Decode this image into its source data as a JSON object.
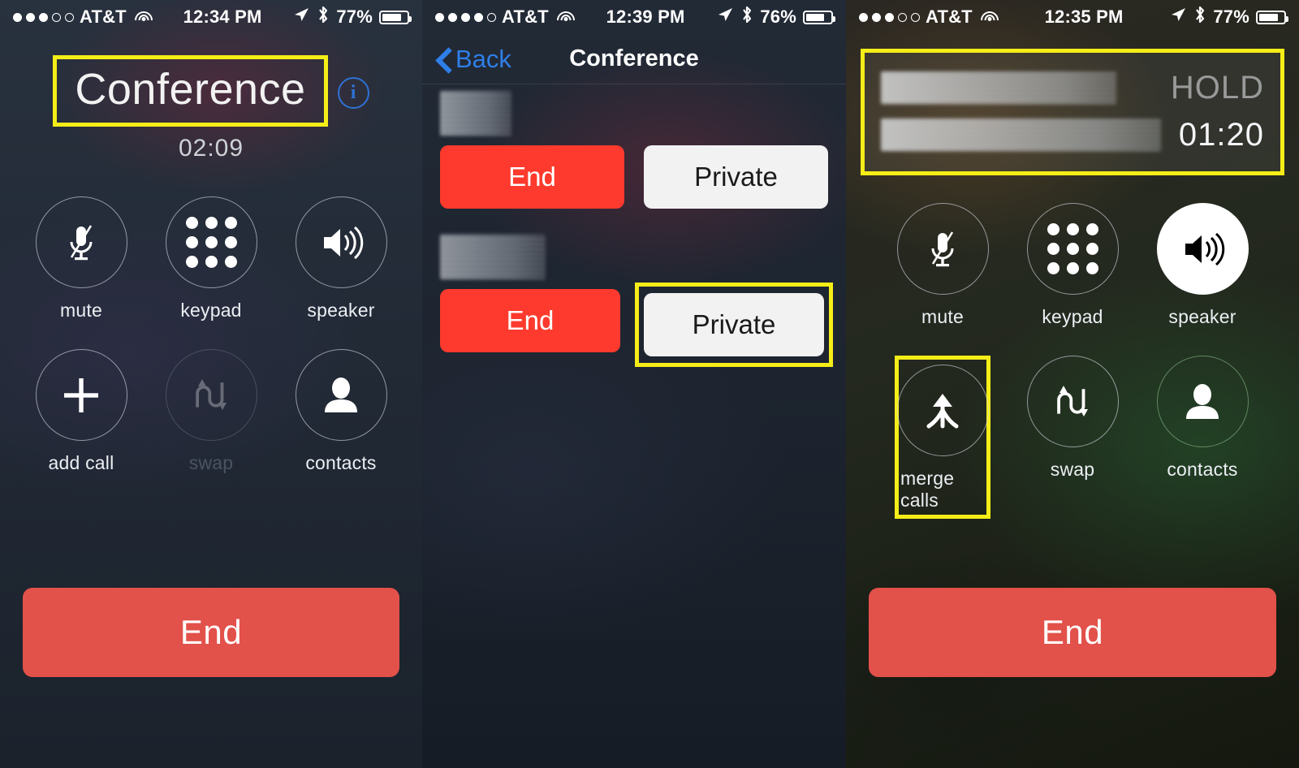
{
  "panels": {
    "left": {
      "status": {
        "carrier": "AT&T",
        "signal_filled": 3,
        "signal_total": 5,
        "time": "12:34 PM",
        "battery": "77%",
        "wifi_icon": "wifi-icon",
        "location_icon": "location-arrow-icon",
        "bluetooth_icon": "bluetooth-icon"
      },
      "call": {
        "title": "Conference",
        "timer": "02:09",
        "info_icon": "info-circle-icon"
      },
      "buttons": [
        {
          "label": "mute",
          "icon": "microphone-muted-icon",
          "state": "normal"
        },
        {
          "label": "keypad",
          "icon": "keypad-dots-icon",
          "state": "normal"
        },
        {
          "label": "speaker",
          "icon": "speaker-waves-icon",
          "state": "normal"
        },
        {
          "label": "add call",
          "icon": "plus-icon",
          "state": "normal"
        },
        {
          "label": "swap",
          "icon": "swap-arrows-icon",
          "state": "disabled"
        },
        {
          "label": "contacts",
          "icon": "person-icon",
          "state": "normal"
        }
      ],
      "end_label": "End",
      "highlight": "conference-title"
    },
    "middle": {
      "status": {
        "carrier": "AT&T",
        "signal_filled": 4,
        "signal_total": 5,
        "time": "12:39 PM",
        "battery": "76%",
        "wifi_icon": "wifi-icon",
        "location_icon": "location-arrow-icon",
        "bluetooth_icon": "bluetooth-icon"
      },
      "nav": {
        "back_label": "Back",
        "back_icon": "chevron-left-icon",
        "title": "Conference"
      },
      "rows": [
        {
          "name_redacted": true,
          "end_label": "End",
          "private_label": "Private",
          "highlighted": false
        },
        {
          "name_redacted": true,
          "end_label": "End",
          "private_label": "Private",
          "highlighted": true
        }
      ]
    },
    "right": {
      "status": {
        "carrier": "AT&T",
        "signal_filled": 3,
        "signal_total": 5,
        "time": "12:35 PM",
        "battery": "77%",
        "wifi_icon": "wifi-icon",
        "location_icon": "location-arrow-icon",
        "bluetooth_icon": "bluetooth-icon"
      },
      "calls": [
        {
          "name_redacted": true,
          "status": "HOLD"
        },
        {
          "name_redacted": true,
          "status": "01:20"
        }
      ],
      "buttons": [
        {
          "label": "mute",
          "icon": "microphone-muted-icon",
          "state": "normal"
        },
        {
          "label": "keypad",
          "icon": "keypad-dots-icon",
          "state": "normal"
        },
        {
          "label": "speaker",
          "icon": "speaker-waves-icon",
          "state": "active"
        },
        {
          "label": "merge calls",
          "icon": "merge-arrow-icon",
          "state": "highlighted"
        },
        {
          "label": "swap",
          "icon": "swap-arrows-icon",
          "state": "normal"
        },
        {
          "label": "contacts",
          "icon": "person-icon",
          "state": "normal"
        }
      ],
      "end_label": "End",
      "highlights": [
        "hold-card",
        "merge-calls-button"
      ]
    }
  },
  "colors": {
    "highlight": "#F5ED18",
    "end_red": "#E2514A",
    "row_end_red": "#FD3A2D",
    "ios_blue": "#2F7FE8",
    "info_blue": "#2F72D6",
    "private_white": "#F2F2F2"
  }
}
